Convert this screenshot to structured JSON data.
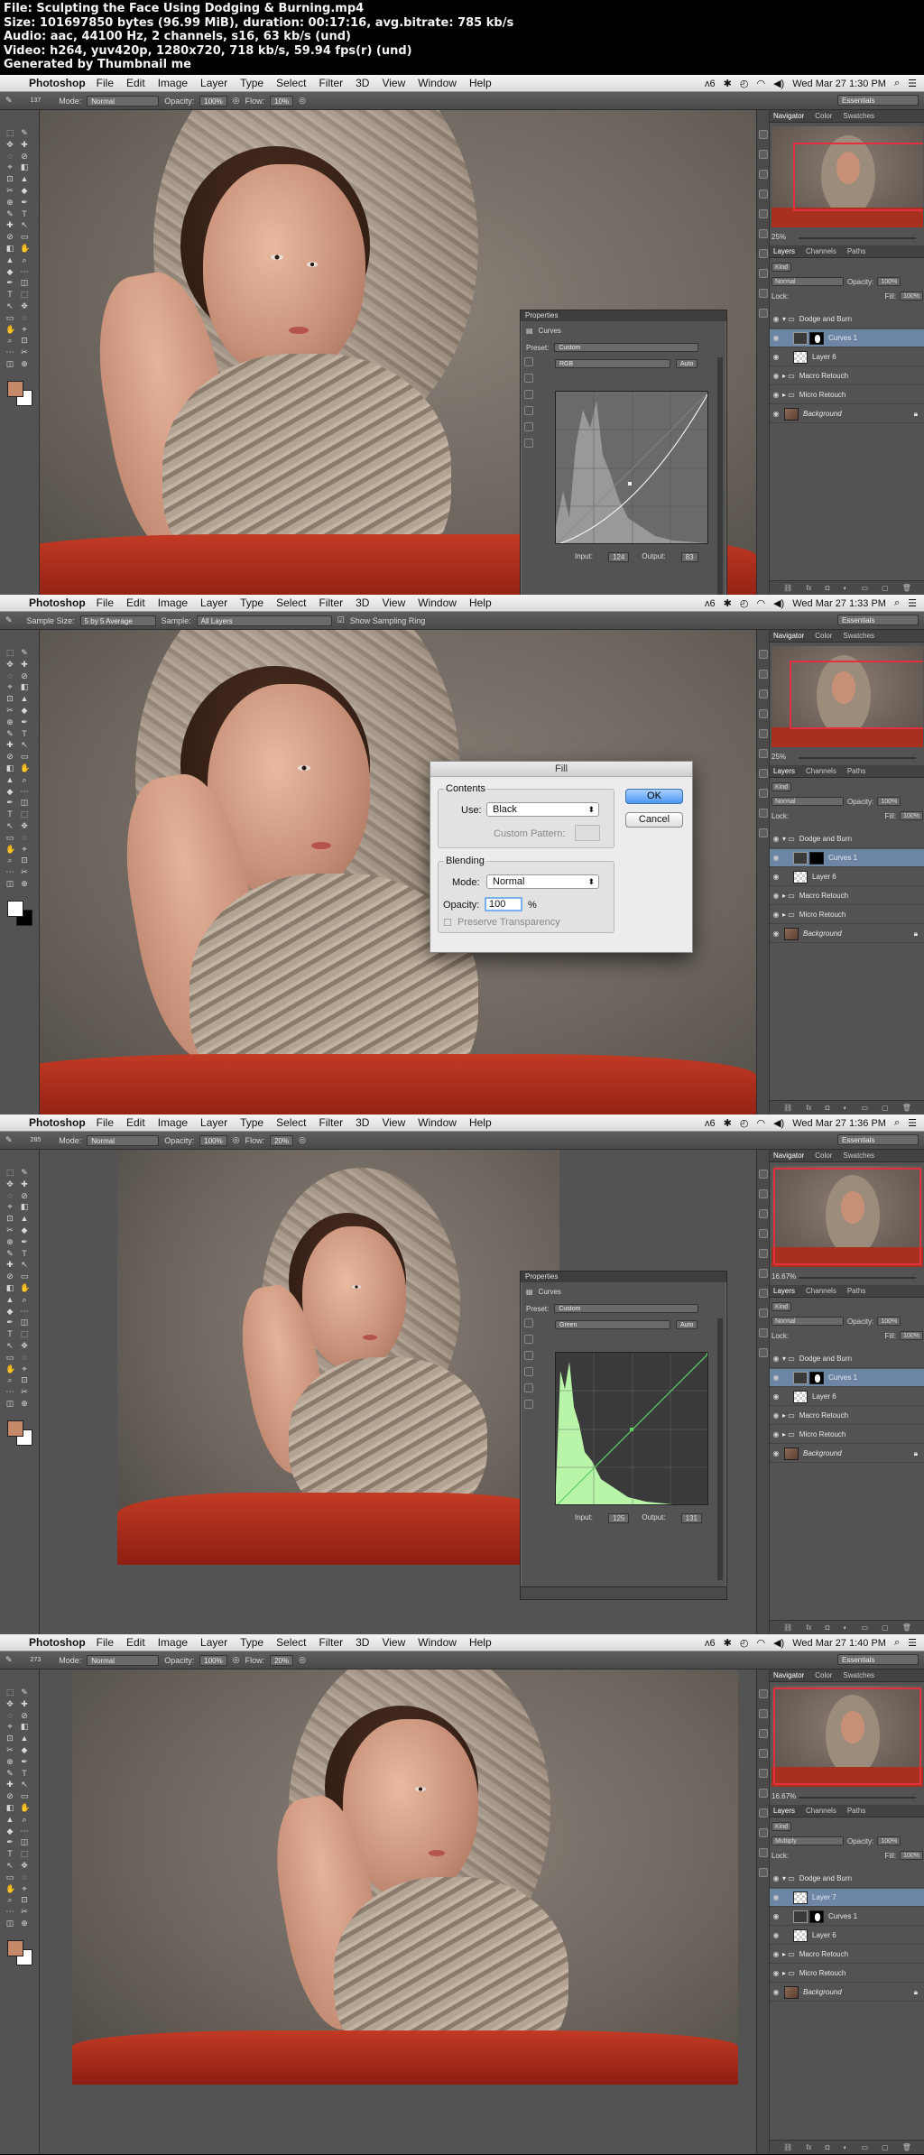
{
  "header": {
    "line1": "File: Sculpting the Face Using Dodging & Burning.mp4",
    "line2": "Size: 101697850 bytes (96.99 MiB), duration: 00:17:16, avg.bitrate: 785 kb/s",
    "line3": "Audio: aac, 44100 Hz, 2 channels, s16, 63 kb/s (und)",
    "line4": "Video: h264, yuv420p, 1280x720, 718 kb/s, 59.94 fps(r) (und)",
    "line5": "Generated by Thumbnail me"
  },
  "menubar": {
    "app": "Photoshop",
    "items": [
      "File",
      "Edit",
      "Image",
      "Layer",
      "Type",
      "Select",
      "Filter",
      "3D",
      "View",
      "Window",
      "Help"
    ],
    "status": "6"
  },
  "frames": [
    {
      "clock": "Wed Mar 27  1:30 PM",
      "options": {
        "mode_label": "Mode:",
        "mode": "Normal",
        "opacity_label": "Opacity:",
        "opacity": "100%",
        "flow_label": "Flow:",
        "flow": "10%",
        "brush_size": "137"
      },
      "workspace": "Essentials",
      "panels": {
        "navigator": "Navigator",
        "color": "Color",
        "swatches": "Swatches",
        "zoom": "25%",
        "layers_tabs": [
          "Layers",
          "Channels",
          "Paths"
        ],
        "kind": "Kind",
        "blend": "Normal",
        "opacity_label": "Opacity:",
        "opacity": "100%",
        "lock_label": "Lock:",
        "fill_label": "Fill:",
        "fill": "100%"
      },
      "layers": [
        "Dodge and Burn",
        "Curves 1",
        "Layer 6",
        "Macro Retouch",
        "Micro Retouch",
        "Background"
      ],
      "properties": {
        "title": "Properties",
        "panel": "Curves",
        "preset_label": "Preset:",
        "preset": "Custom",
        "channel": "RGB",
        "auto": "Auto",
        "input_label": "Input:",
        "input": "124",
        "output_label": "Output:",
        "output": "83"
      }
    },
    {
      "clock": "Wed Mar 27  1:33 PM",
      "options": {
        "sample_size_label": "Sample Size:",
        "sample_size": "5 by 5 Average",
        "sample_label": "Sample:",
        "sample": "All Layers",
        "ring": "Show Sampling Ring"
      },
      "workspace": "Essentials",
      "panels": {
        "navigator": "Navigator",
        "color": "Color",
        "swatches": "Swatches",
        "zoom": "25%",
        "layers_tabs": [
          "Layers",
          "Channels",
          "Paths"
        ],
        "kind": "Kind",
        "blend": "Normal",
        "opacity_label": "Opacity:",
        "opacity": "100%",
        "lock_label": "Lock:",
        "fill_label": "Fill:",
        "fill": "100%"
      },
      "layers": [
        "Dodge and Burn",
        "Curves 1",
        "Layer 6",
        "Macro Retouch",
        "Micro Retouch",
        "Background"
      ],
      "fill_dialog": {
        "title": "Fill",
        "contents_legend": "Contents",
        "use_label": "Use:",
        "use": "Black",
        "custom_pattern_label": "Custom Pattern:",
        "blending_legend": "Blending",
        "mode_label": "Mode:",
        "mode": "Normal",
        "opacity_label": "Opacity:",
        "opacity": "100",
        "percent": "%",
        "preserve": "Preserve Transparency",
        "ok": "OK",
        "cancel": "Cancel"
      }
    },
    {
      "clock": "Wed Mar 27  1:36 PM",
      "options": {
        "mode_label": "Mode:",
        "mode": "Normal",
        "opacity_label": "Opacity:",
        "opacity": "100%",
        "flow_label": "Flow:",
        "flow": "20%",
        "brush_size": "285"
      },
      "workspace": "Essentials",
      "panels": {
        "navigator": "Navigator",
        "color": "Color",
        "swatches": "Swatches",
        "zoom": "16.67%",
        "layers_tabs": [
          "Layers",
          "Channels",
          "Paths"
        ],
        "kind": "Kind",
        "blend": "Normal",
        "opacity_label": "Opacity:",
        "opacity": "100%",
        "lock_label": "Lock:",
        "fill_label": "Fill:",
        "fill": "100%"
      },
      "layers": [
        "Dodge and Burn",
        "Curves 1",
        "Layer 6",
        "Macro Retouch",
        "Micro Retouch",
        "Background"
      ],
      "properties": {
        "title": "Properties",
        "panel": "Curves",
        "preset_label": "Preset:",
        "preset": "Custom",
        "channel": "Green",
        "auto": "Auto",
        "input_label": "Input:",
        "input": "125",
        "output_label": "Output:",
        "output": "131"
      }
    },
    {
      "clock": "Wed Mar 27  1:40 PM",
      "options": {
        "mode_label": "Mode:",
        "mode": "Normal",
        "opacity_label": "Opacity:",
        "opacity": "100%",
        "flow_label": "Flow:",
        "flow": "20%",
        "brush_size": "273"
      },
      "workspace": "Essentials",
      "panels": {
        "navigator": "Navigator",
        "color": "Color",
        "swatches": "Swatches",
        "zoom": "16.67%",
        "layers_tabs": [
          "Layers",
          "Channels",
          "Paths"
        ],
        "kind": "Kind",
        "blend": "Multiply",
        "opacity_label": "Opacity:",
        "opacity": "100%",
        "lock_label": "Lock:",
        "fill_label": "Fill:",
        "fill": "100%"
      },
      "layers": [
        "Dodge and Burn",
        "Layer 7",
        "Curves 1",
        "Layer 6",
        "Macro Retouch",
        "Micro Retouch",
        "Background"
      ]
    }
  ],
  "colors": {
    "selection": "#6d86a6",
    "navigator_box": "#e23040",
    "curve_green": "#5fd05f",
    "dialog_ok": "#4d97f0"
  }
}
